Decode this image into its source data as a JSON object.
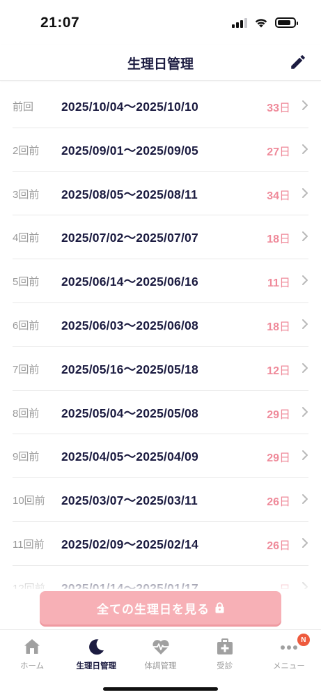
{
  "status_bar": {
    "time": "21:07",
    "icons": [
      "cellular-signal-icon",
      "wifi-icon",
      "battery-icon"
    ]
  },
  "header": {
    "title": "生理日管理",
    "edit_icon": "pencil-icon"
  },
  "periods": [
    {
      "label": "前回",
      "range": "2025/10/04〜2025/10/10",
      "days": "33",
      "unit": "日"
    },
    {
      "label": "2回前",
      "range": "2025/09/01〜2025/09/05",
      "days": "27",
      "unit": "日"
    },
    {
      "label": "3回前",
      "range": "2025/08/05〜2025/08/11",
      "days": "34",
      "unit": "日"
    },
    {
      "label": "4回前",
      "range": "2025/07/02〜2025/07/07",
      "days": "18",
      "unit": "日"
    },
    {
      "label": "5回前",
      "range": "2025/06/14〜2025/06/16",
      "days": "11",
      "unit": "日"
    },
    {
      "label": "6回前",
      "range": "2025/06/03〜2025/06/08",
      "days": "18",
      "unit": "日"
    },
    {
      "label": "7回前",
      "range": "2025/05/16〜2025/05/18",
      "days": "12",
      "unit": "日"
    },
    {
      "label": "8回前",
      "range": "2025/05/04〜2025/05/08",
      "days": "29",
      "unit": "日"
    },
    {
      "label": "9回前",
      "range": "2025/04/05〜2025/04/09",
      "days": "29",
      "unit": "日"
    },
    {
      "label": "10回前",
      "range": "2025/03/07〜2025/03/11",
      "days": "26",
      "unit": "日"
    },
    {
      "label": "11回前",
      "range": "2025/02/09〜2025/02/14",
      "days": "26",
      "unit": "日"
    },
    {
      "label": "12回前",
      "range": "2025/01/14〜2025/01/17",
      "days": "",
      "unit": "日"
    }
  ],
  "see_all_button": {
    "label": "全ての生理日を見る",
    "icon": "lock-icon"
  },
  "tabs": [
    {
      "label": "ホーム",
      "icon": "home-icon",
      "active": false
    },
    {
      "label": "生理日管理",
      "icon": "moon-icon",
      "active": true
    },
    {
      "label": "体調管理",
      "icon": "heart-pulse-icon",
      "active": false
    },
    {
      "label": "受診",
      "icon": "medical-kit-icon",
      "active": false
    },
    {
      "label": "メニュー",
      "icon": "more-dots-icon",
      "active": false,
      "badge": "N"
    }
  ],
  "colors": {
    "accent_navy": "#1b1b40",
    "days_pink": "#ef8a9a",
    "button_pink": "#f7b0b6",
    "badge_orange": "#ee5a3d",
    "inactive_gray": "#9a9a9a"
  }
}
